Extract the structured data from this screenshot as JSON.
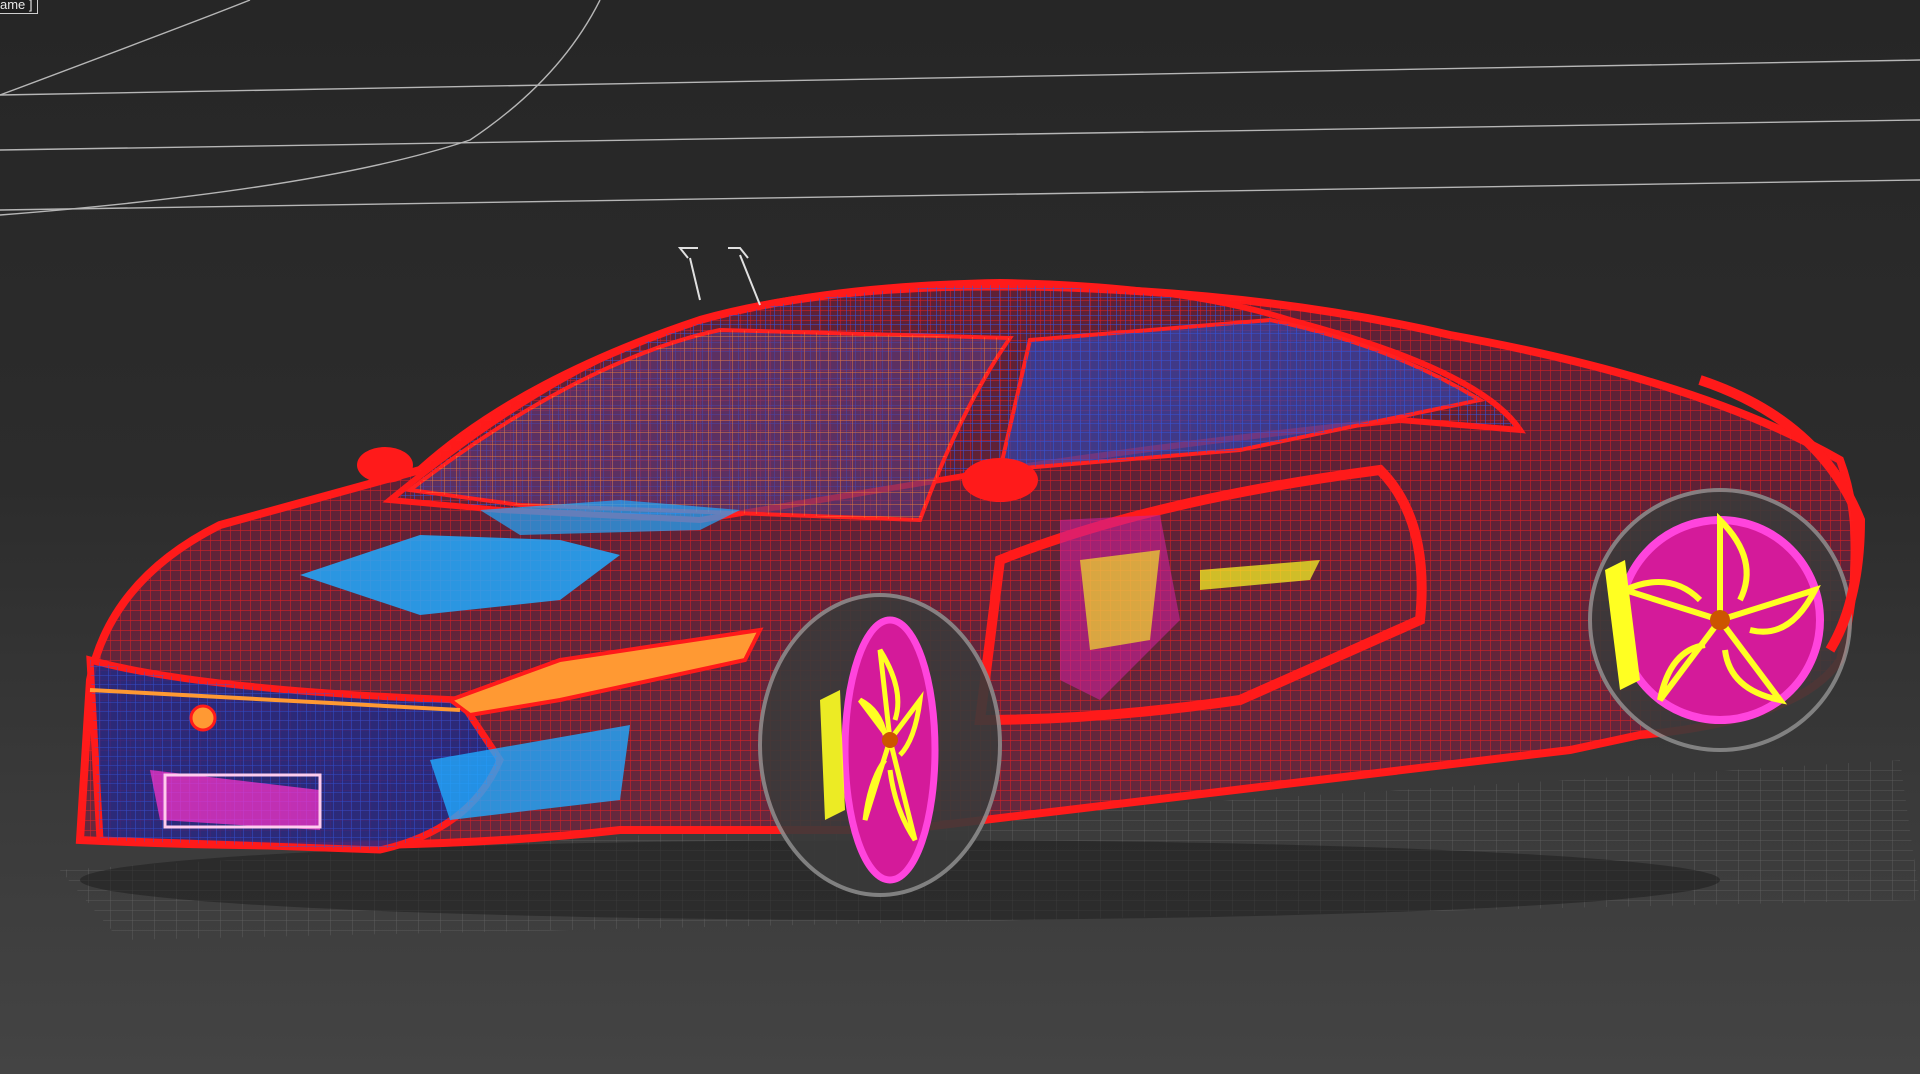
{
  "viewport": {
    "label": "ame ]",
    "background": "#2b2b2b",
    "display_mode": "wireframe"
  },
  "colors": {
    "body_wire": "#ff1a1a",
    "interior_wire": "#2244cc",
    "accent_cyan": "#22aaff",
    "wheel_magenta": "#ff22cc",
    "wheel_spokes": "#ffff22",
    "headlight_orange": "#ff9933",
    "grid": "#8a8a8a",
    "horizon_lines": "#d0d0d0"
  }
}
